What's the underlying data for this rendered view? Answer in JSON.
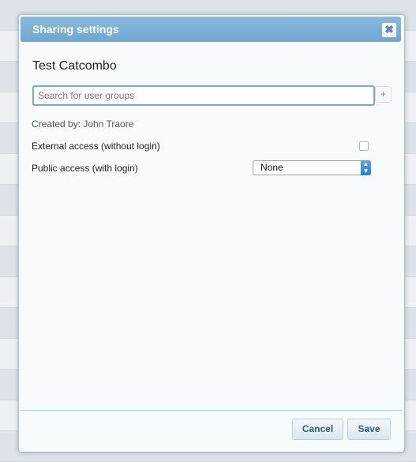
{
  "dialog": {
    "title": "Sharing settings",
    "close_glyph": "✖",
    "object_name": "Test Catcombo"
  },
  "search": {
    "placeholder": "Search for user groups",
    "value": "",
    "add_glyph": "+"
  },
  "meta": {
    "created_by": "Created by: John Traore"
  },
  "access": {
    "external_label": "External access (without login)",
    "external_checked": false,
    "public_label": "Public access (with login)",
    "public_value": "None",
    "public_arrow_up": "▲",
    "public_arrow_down": "▼"
  },
  "footer": {
    "cancel_label": "Cancel",
    "save_label": "Save"
  },
  "colors": {
    "titlebar": "#7fb0d8",
    "accent": "#2b7ae0",
    "button_text": "#2d5f86"
  },
  "icons": [
    "close-icon",
    "add-icon",
    "select-arrow-icon",
    "checkbox-icon"
  ]
}
